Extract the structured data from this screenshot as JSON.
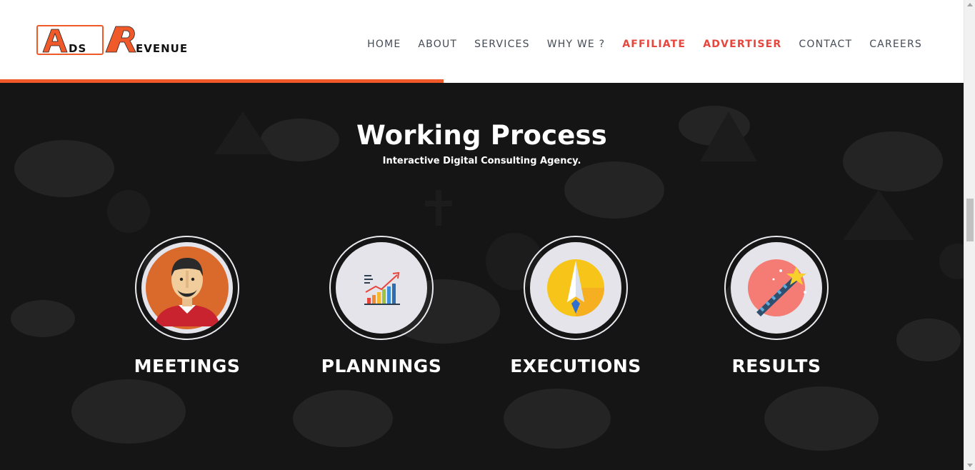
{
  "logo": {
    "text": "ADS REVENUE",
    "brand_color": "#f05a2a"
  },
  "nav": {
    "items": [
      {
        "label": "HOME",
        "accent": false
      },
      {
        "label": "ABOUT",
        "accent": false
      },
      {
        "label": "SERVICES",
        "accent": false
      },
      {
        "label": "WHY WE ?",
        "accent": false
      },
      {
        "label": "AFFILIATE",
        "accent": true
      },
      {
        "label": "ADVERTISER",
        "accent": true
      },
      {
        "label": "CONTACT",
        "accent": false
      },
      {
        "label": "CAREERS",
        "accent": false
      }
    ],
    "accent_color": "#e8453c"
  },
  "page_progress": 0.46,
  "section": {
    "title": "Working Process",
    "subtitle": "Interactive Digital Consulting Agency.",
    "steps": [
      {
        "label": "MEETINGS",
        "icon": "businessman-icon"
      },
      {
        "label": "PLANNINGS",
        "icon": "growth-chart-icon"
      },
      {
        "label": "EXECUTIONS",
        "icon": "paper-plane-icon"
      },
      {
        "label": "RESULTS",
        "icon": "magic-wand-icon"
      }
    ]
  }
}
